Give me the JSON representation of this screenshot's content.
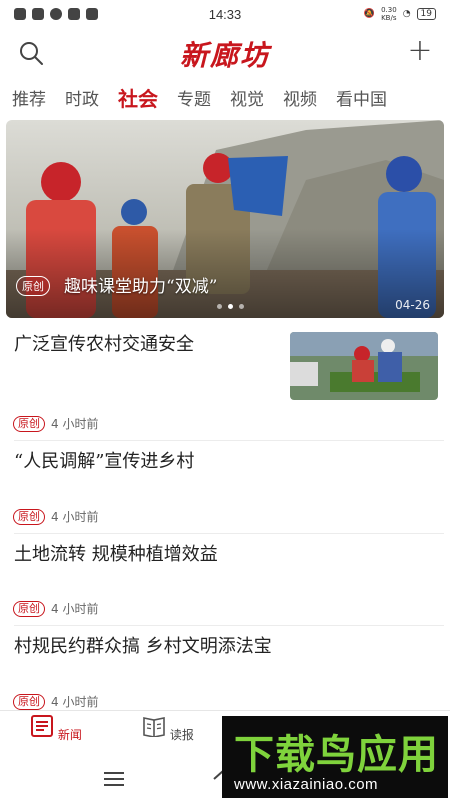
{
  "status_bar": {
    "time": "14:33",
    "net_speed": "0.30\nKB/s",
    "battery": "19"
  },
  "header": {
    "logo_text": "新廊坊",
    "search_icon": "search-icon",
    "add_icon": "plus-icon"
  },
  "tabs": [
    {
      "label": "推荐"
    },
    {
      "label": "时政"
    },
    {
      "label": "社会",
      "active": true
    },
    {
      "label": "专题"
    },
    {
      "label": "视觉"
    },
    {
      "label": "视频"
    },
    {
      "label": "看中国"
    }
  ],
  "hero": {
    "tag": "原创",
    "caption": "趣味课堂助力“双减”",
    "date": "04-26"
  },
  "news": [
    {
      "title": "广泛宣传农村交通安全",
      "tag": "原创",
      "time": "4  小时前"
    },
    {
      "title": "“人民调解”宣传进乡村",
      "tag": "原创",
      "time": "4  小时前"
    },
    {
      "title": "土地流转  规模种植增效益",
      "tag": "原创",
      "time": "4  小时前"
    },
    {
      "title": "村规民约群众搞  乡村文明添法宝",
      "tag": "原创",
      "time": "4  小时前"
    }
  ],
  "bottom_nav": [
    {
      "label": "新闻",
      "icon": "news-icon",
      "active": true
    },
    {
      "label": "读报",
      "icon": "newspaper-icon"
    }
  ],
  "watermark": {
    "brand": "下载鸟应用",
    "url": "www.xiazainiao.com"
  },
  "colors": {
    "accent": "#c8161d",
    "watermark_green": "#7fd33c"
  }
}
